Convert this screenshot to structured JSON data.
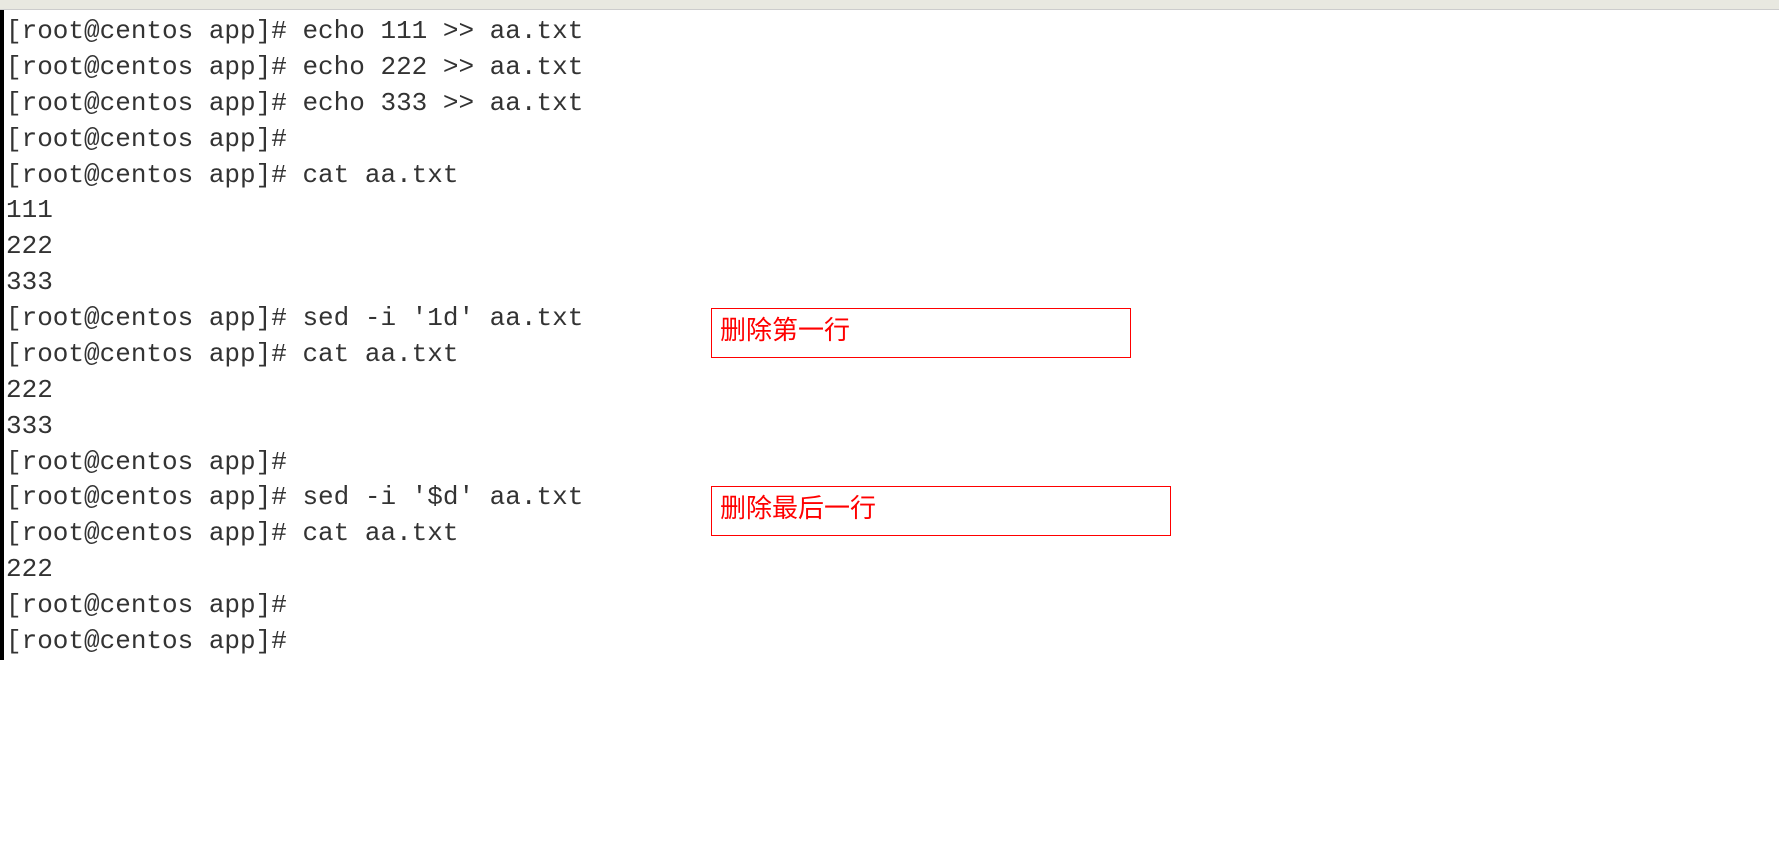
{
  "lines": [
    "[root@centos app]# echo 111 >> aa.txt",
    "[root@centos app]# echo 222 >> aa.txt",
    "[root@centos app]# echo 333 >> aa.txt",
    "[root@centos app]# ",
    "[root@centos app]# cat aa.txt",
    "111",
    "222",
    "333",
    "[root@centos app]# sed -i '1d' aa.txt",
    "[root@centos app]# cat aa.txt",
    "222",
    "333",
    "[root@centos app]# ",
    "[root@centos app]# sed -i '$d' aa.txt",
    "[root@centos app]# cat aa.txt",
    "222",
    "[root@centos app]# ",
    "[root@centos app]# "
  ],
  "annotations": {
    "anno1": "删除第一行",
    "anno2": "删除最后一行"
  }
}
